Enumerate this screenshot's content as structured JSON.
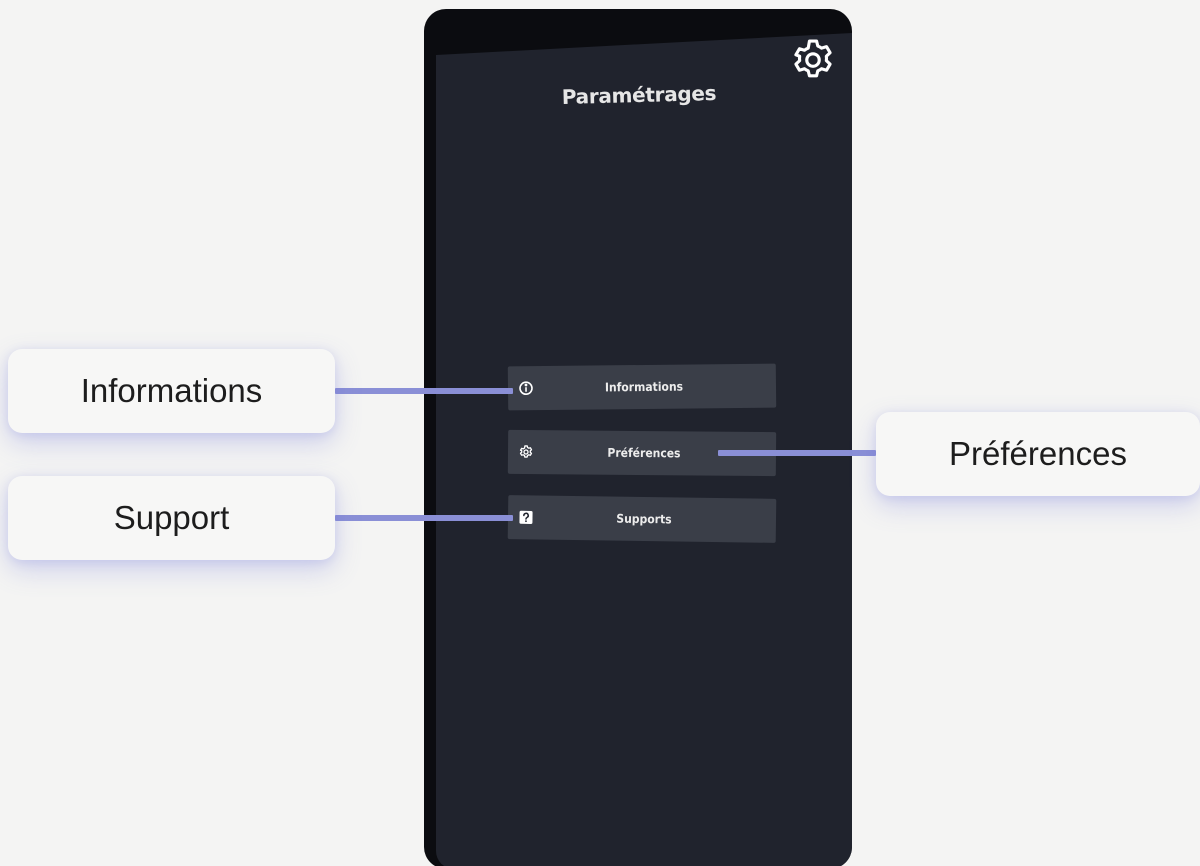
{
  "panel": {
    "title": "Paramétrages",
    "top_icon": "gear-icon",
    "menu": [
      {
        "label": "Informations",
        "icon": "info-icon"
      },
      {
        "label": "Préférences",
        "icon": "gear-icon"
      },
      {
        "label": "Supports",
        "icon": "help-icon"
      }
    ]
  },
  "callouts": {
    "informations": "Informations",
    "support": "Support",
    "preferences": "Préférences"
  },
  "colors": {
    "page_background": "#f4f4f3",
    "panel_background": "#20232d",
    "panel_shell": "#0b0c10",
    "button_background": "#3a3e48",
    "connector": "#8a8fd6",
    "callout_background": "#f7f7f6"
  }
}
